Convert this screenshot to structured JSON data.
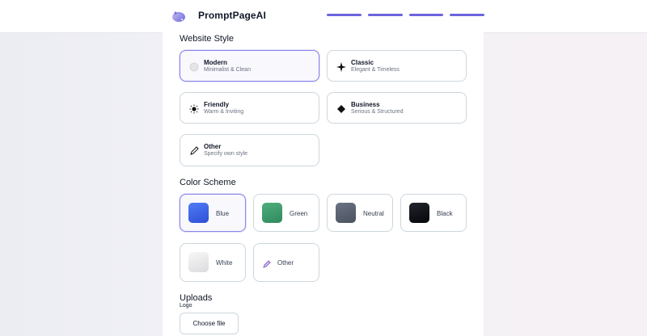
{
  "header": {
    "brand": "PromptPageAI",
    "logo_icon": "sparkle-orb-icon"
  },
  "website_style": {
    "title": "Website Style",
    "options": [
      {
        "name": "Modern",
        "description": "Minimalist & Clean",
        "icon": "circle-icon",
        "selected": true
      },
      {
        "name": "Classic",
        "description": "Elegant & Timeless",
        "icon": "sparkle-icon",
        "selected": false
      },
      {
        "name": "Friendly",
        "description": "Warm & Inviting",
        "icon": "sun-icon",
        "selected": false
      },
      {
        "name": "Business",
        "description": "Serious & Structured",
        "icon": "diamond-icon",
        "selected": false
      },
      {
        "name": "Other",
        "description": "Specify own style",
        "icon": "pencil-icon",
        "selected": false
      }
    ]
  },
  "color_scheme": {
    "title": "Color Scheme",
    "options": [
      {
        "name": "Blue",
        "color": "#3b5fe0",
        "selected": true
      },
      {
        "name": "Green",
        "color": "#3f9a6e",
        "selected": false
      },
      {
        "name": "Neutral",
        "color": "#5b6474",
        "selected": false
      },
      {
        "name": "Black",
        "color": "#0d0f14",
        "selected": false
      },
      {
        "name": "White",
        "color": "#eeeeef",
        "selected": false
      },
      {
        "name": "Other",
        "icon": "pencil-icon",
        "selected": false
      }
    ]
  },
  "uploads": {
    "title": "Uploads",
    "logo_label": "Logo",
    "choose_file_label": "Choose file"
  },
  "colors": {
    "accent": "#6c63de",
    "selected_border": "#8b86ea"
  }
}
